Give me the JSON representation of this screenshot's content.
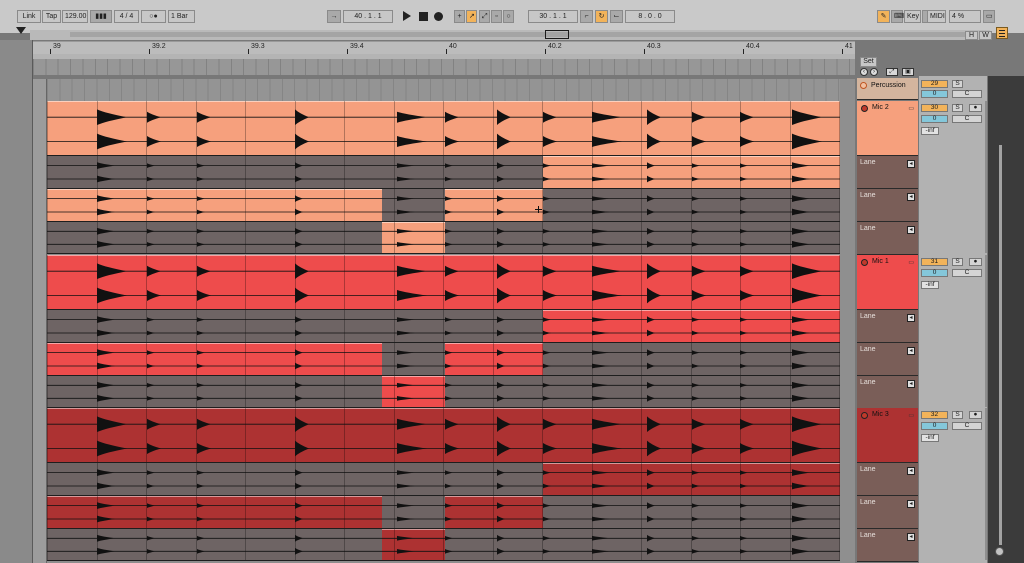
{
  "transport": {
    "link": "Link",
    "tap": "Tap",
    "tempo": "129.00",
    "time_sig": "4 / 4",
    "metronome": "○●",
    "quantize": "1 Bar",
    "position": "40 . 1 . 1",
    "loop_start": "30 . 1 . 1",
    "loop_length": "8 . 0 . 0",
    "key": "Key",
    "midi": "MIDI",
    "cpu": "4 %"
  },
  "overview_buttons": {
    "h": "H",
    "w": "W"
  },
  "ruler": {
    "labels": [
      "39",
      "39.2",
      "39.3",
      "39.4",
      "40",
      "40.2",
      "40.3",
      "40.4",
      "41"
    ],
    "set_label": "Set"
  },
  "tracks": [
    {
      "name": "Percussion",
      "vol": "29",
      "pan": "0",
      "pan_mode": "C",
      "solo": "S",
      "color": "#f6a06a"
    },
    {
      "name": "Mic 2",
      "vol": "30",
      "pan": "0",
      "pan_mode": "C",
      "solo": "S",
      "inf": "-inf",
      "color": "#f6a07d"
    },
    {
      "name": "Mic 1",
      "vol": "31",
      "pan": "0",
      "pan_mode": "C",
      "solo": "S",
      "inf": "-inf",
      "color": "#ee4c4c"
    },
    {
      "name": "Mic 3",
      "vol": "32",
      "pan": "0",
      "pan_mode": "C",
      "solo": "S",
      "inf": "-inf",
      "color": "#ad3232"
    }
  ],
  "lane_label": "Lane",
  "colors": {
    "mic2": "#f6a07d",
    "mic1": "#ee4c4c",
    "mic3": "#ad3232",
    "inactive": "#6e6464",
    "accent_orange": "#f2b35a",
    "accent_blue": "#84c7da"
  }
}
